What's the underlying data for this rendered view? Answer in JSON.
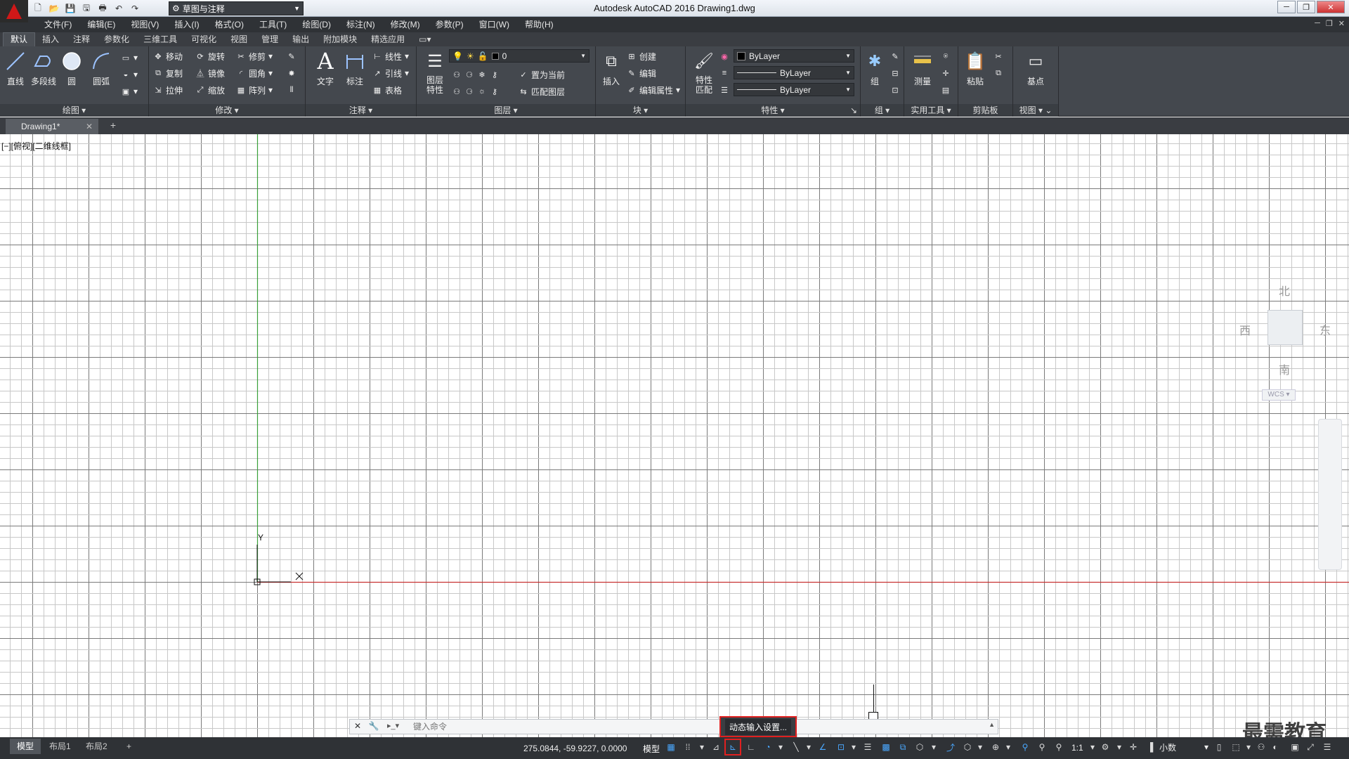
{
  "titlebar": {
    "app_title": "Autodesk AutoCAD 2016    Drawing1.dwg",
    "workspace": "草图与注释",
    "qat_icons": [
      "new-icon",
      "open-icon",
      "save-icon",
      "save-as-icon",
      "plot-icon",
      "undo-icon",
      "redo-icon"
    ]
  },
  "menubar": {
    "items": [
      "文件(F)",
      "编辑(E)",
      "视图(V)",
      "插入(I)",
      "格式(O)",
      "工具(T)",
      "绘图(D)",
      "标注(N)",
      "修改(M)",
      "参数(P)",
      "窗口(W)",
      "帮助(H)"
    ]
  },
  "ribbon_tabs": [
    "默认",
    "插入",
    "注释",
    "参数化",
    "三维工具",
    "可视化",
    "视图",
    "管理",
    "输出",
    "附加模块",
    "精选应用"
  ],
  "ribbon": {
    "draw": {
      "title": "绘图",
      "line": "直线",
      "polyline": "多段线",
      "circle": "圆",
      "arc": "圆弧"
    },
    "modify": {
      "title": "修改",
      "move": "移动",
      "rotate": "旋转",
      "trim": "修剪",
      "copy": "复制",
      "mirror": "镜像",
      "fillet": "圆角",
      "stretch": "拉伸",
      "scale": "缩放",
      "array": "阵列"
    },
    "annotation": {
      "title": "注释",
      "text": "文字",
      "dimension": "标注",
      "linear": "线性",
      "leader": "引线",
      "table": "表格"
    },
    "layers": {
      "title": "图层",
      "layer_props": "图层\n特性",
      "layer_value": "0",
      "set_current": "置为当前",
      "match_layer": "匹配图层"
    },
    "block": {
      "title": "块",
      "insert": "插入",
      "create": "创建",
      "edit": "编辑",
      "edit_attr": "编辑属性"
    },
    "properties": {
      "title": "特性",
      "match": "特性\n匹配",
      "color": "ByLayer",
      "linetype": "ByLayer",
      "lineweight": "ByLayer"
    },
    "groups": {
      "title": "组",
      "group": "组"
    },
    "utilities": {
      "title": "实用工具",
      "measure": "测量"
    },
    "clipboard": {
      "title": "剪贴板",
      "paste": "粘贴"
    },
    "view": {
      "title": "视图",
      "base": "基点"
    }
  },
  "file_tab": {
    "name": "Drawing1*"
  },
  "drawing": {
    "viewport_label": "[−][俯视][二维线框]",
    "ucs_x": "X",
    "ucs_y": "Y"
  },
  "viewcube": {
    "north": "北",
    "south": "南",
    "east": "东",
    "west": "西",
    "wcs": "WCS"
  },
  "cmdline": {
    "placeholder": "键入命令"
  },
  "tooltip": {
    "text": "动态输入设置..."
  },
  "statusbar": {
    "layouts": [
      "模型",
      "布局1",
      "布局2"
    ],
    "coords": "275.0844, -59.9227, 0.0000",
    "model": "模型",
    "scale": "1:1",
    "units": "小数"
  },
  "watermark": "最需教育",
  "colors": {
    "grid_minor": "#c8c8c8",
    "grid_major": "#7a7a7a",
    "x_axis": "#c83232",
    "y_axis": "#3aa03a",
    "highlight": "#e02020"
  }
}
